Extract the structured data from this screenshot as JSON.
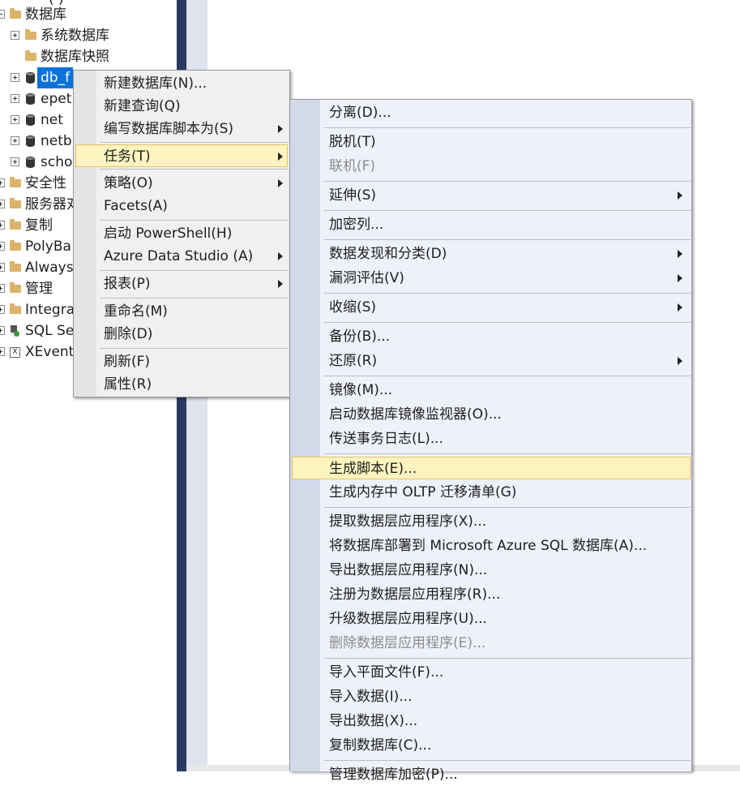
{
  "tree": {
    "header_partial": "(   )",
    "items": [
      {
        "label": "数据库"
      },
      {
        "label": "系统数据库"
      },
      {
        "label": "数据库快照"
      },
      {
        "label": "db_f"
      },
      {
        "label": "epet"
      },
      {
        "label": "net"
      },
      {
        "label": "netb"
      },
      {
        "label": "scho"
      },
      {
        "label": "安全性"
      },
      {
        "label": "服务器对"
      },
      {
        "label": "复制"
      },
      {
        "label": "PolyBa"
      },
      {
        "label": "Always"
      },
      {
        "label": "管理"
      },
      {
        "label": "Integra"
      },
      {
        "label": "SQL Se"
      },
      {
        "label": "XEvent"
      }
    ]
  },
  "context_menu": {
    "items": [
      {
        "label": "新建数据库(N)..."
      },
      {
        "label": "新建查询(Q)"
      },
      {
        "label": "编写数据库脚本为(S)"
      },
      {
        "label": "任务(T)"
      },
      {
        "label": "策略(O)"
      },
      {
        "label": "Facets(A)"
      },
      {
        "label": "启动 PowerShell(H)"
      },
      {
        "label": "Azure Data Studio (A)"
      },
      {
        "label": "报表(P)"
      },
      {
        "label": "重命名(M)"
      },
      {
        "label": "删除(D)"
      },
      {
        "label": "刷新(F)"
      },
      {
        "label": "属性(R)"
      }
    ]
  },
  "tasks_submenu": {
    "items": [
      {
        "label": "分离(D)..."
      },
      {
        "label": "脱机(T)"
      },
      {
        "label": "联机(F)"
      },
      {
        "label": "延伸(S)"
      },
      {
        "label": "加密列..."
      },
      {
        "label": "数据发现和分类(D)"
      },
      {
        "label": "漏洞评估(V)"
      },
      {
        "label": "收缩(S)"
      },
      {
        "label": "备份(B)..."
      },
      {
        "label": "还原(R)"
      },
      {
        "label": "镜像(M)..."
      },
      {
        "label": "启动数据库镜像监视器(O)..."
      },
      {
        "label": "传送事务日志(L)..."
      },
      {
        "label": "生成脚本(E)..."
      },
      {
        "label": "生成内存中 OLTP 迁移清单(G)"
      },
      {
        "label": "提取数据层应用程序(X)..."
      },
      {
        "label": "将数据库部署到 Microsoft Azure SQL 数据库(A)..."
      },
      {
        "label": "导出数据层应用程序(N)..."
      },
      {
        "label": "注册为数据层应用程序(R)..."
      },
      {
        "label": "升级数据层应用程序(U)..."
      },
      {
        "label": "删除数据层应用程序(E)..."
      },
      {
        "label": "导入平面文件(F)..."
      },
      {
        "label": "导入数据(I)..."
      },
      {
        "label": "导出数据(X)..."
      },
      {
        "label": "复制数据库(C)..."
      },
      {
        "label": "管理数据库加密(P)..."
      }
    ]
  },
  "colors": {
    "selection": "#0b72d9",
    "highlight": "#fdf4bf",
    "highlight_border": "#e5c365",
    "submenu_bg": "#eef1fb",
    "divider": "#2b3a63"
  }
}
